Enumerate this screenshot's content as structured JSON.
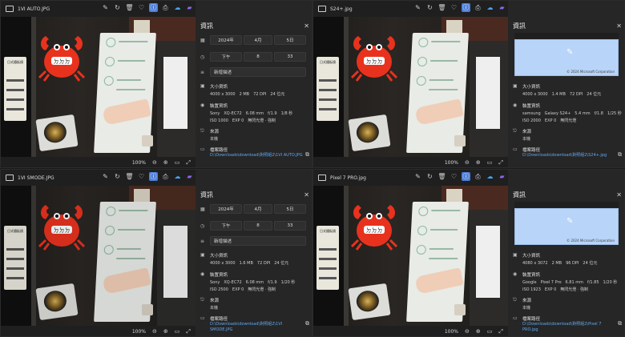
{
  "windows": [
    {
      "filename": "1VI AUTO.JPG",
      "zoom": "100%",
      "panel": {
        "title": "資訊",
        "date_year": "2024年",
        "date_month": "4月",
        "date_day": "5日",
        "time_ampm": "下午",
        "time_hour": "8",
        "time_min": "33",
        "description_placeholder": "新增描述",
        "size_label": "大小資訊",
        "size_values": [
          "4000 x 3000",
          "2 MB",
          "72 DPI",
          "24 位元"
        ],
        "camera_label": "裝置資訊",
        "camera_values": [
          "Sony",
          "XQ-EC72",
          "6.08 mm",
          "f/1.9",
          "1/8 秒"
        ],
        "camera_values2": [
          "ISO 1000",
          "EXP 0",
          "無閃光燈 · 強制"
        ],
        "source_label": "來源",
        "source_value": "本機",
        "path_label": "檔案路徑",
        "path_value": "D:\\Downloads\\download\\對照組2\\1VI AUTO.JPG",
        "has_map": false
      }
    },
    {
      "filename": "S24+.jpg",
      "zoom": "100%",
      "panel": {
        "title": "資訊",
        "map_copyright": "© 2024 Microsoft Corporation",
        "size_label": "大小資訊",
        "size_values": [
          "4000 x 3000",
          "1.4 MB",
          "72 DPI",
          "24 位元"
        ],
        "camera_label": "裝置資訊",
        "camera_values": [
          "samsung",
          "Galaxy S24+",
          "5.4 mm",
          "f/1.8",
          "1/25 秒"
        ],
        "camera_values2": [
          "ISO 2000",
          "EXP 0",
          "無閃光燈"
        ],
        "source_label": "來源",
        "source_value": "本機",
        "path_label": "檔案路徑",
        "path_value": "D:\\Downloads\\download\\對照組2\\S24+.jpg",
        "has_map": true
      }
    },
    {
      "filename": "1VI SMODE.JPG",
      "zoom": "100%",
      "panel": {
        "title": "資訊",
        "date_year": "2024年",
        "date_month": "4月",
        "date_day": "5日",
        "time_ampm": "下午",
        "time_hour": "8",
        "time_min": "33",
        "description_placeholder": "新增描述",
        "size_label": "大小資訊",
        "size_values": [
          "4000 x 3000",
          "1.6 MB",
          "72 DPI",
          "24 位元"
        ],
        "camera_label": "裝置資訊",
        "camera_values": [
          "Sony",
          "XQ-EC72",
          "6.08 mm",
          "f/1.9",
          "1/20 秒"
        ],
        "camera_values2": [
          "ISO 2500",
          "EXP 0",
          "無閃光燈 · 強制"
        ],
        "source_label": "來源",
        "source_value": "本機",
        "path_label": "檔案路徑",
        "path_value": "D:\\Downloads\\download\\對照組2\\1VI SMODE.JPG",
        "has_map": false
      }
    },
    {
      "filename": "Pixel 7 PRO.jpg",
      "zoom": "100%",
      "panel": {
        "title": "資訊",
        "map_copyright": "© 2024 Microsoft Corporation",
        "size_label": "大小資訊",
        "size_values": [
          "4080 x 3072",
          "2 MB",
          "96 DPI",
          "24 位元"
        ],
        "camera_label": "裝置資訊",
        "camera_values": [
          "Google",
          "Pixel 7 Pro",
          "6.81 mm",
          "f/1.85",
          "1/20 秒"
        ],
        "camera_values2": [
          "ISO 1923",
          "EXP 0",
          "無閃光燈 · 強制"
        ],
        "source_label": "來源",
        "source_value": "本機",
        "path_label": "檔案路徑",
        "path_value": "D:\\Downloads\\download\\對照組2\\Pixel 7 PRO.jpg",
        "has_map": true
      }
    }
  ],
  "photo_text": {
    "crab_text": "ㄉㄉㄉ",
    "sign_text": "日式鐵板燒"
  },
  "icons": {
    "toolbar": [
      "edit-icon",
      "rotate-icon",
      "delete-icon",
      "favorite-icon",
      "info-icon",
      "print-icon",
      "onedrive-icon",
      "copilot-icon"
    ],
    "bottom": [
      "zoom-out-icon",
      "zoom-in-icon",
      "fit-icon",
      "fullscreen-icon"
    ]
  },
  "colors": {
    "accent": "#4f7fd8",
    "link": "#62a8f0",
    "crab": "#e8321e"
  }
}
